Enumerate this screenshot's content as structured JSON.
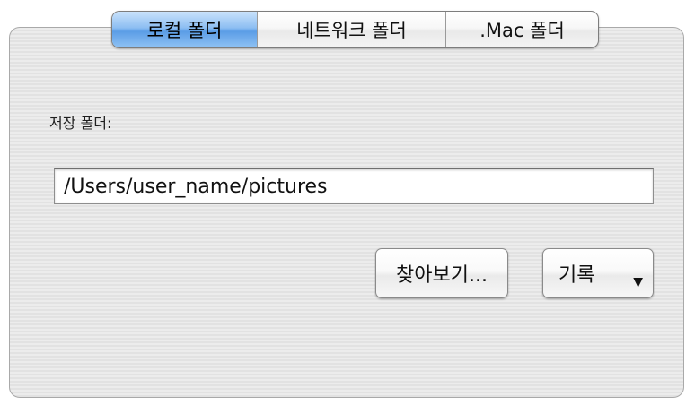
{
  "tabs": {
    "local_folder": "로컬 폴더",
    "network_folder": "네트워크 폴더",
    "mac_folder": ".Mac 폴더",
    "selected": "local_folder"
  },
  "save_folder": {
    "label": "저장 폴더:",
    "path": "/Users/user_name/pictures"
  },
  "buttons": {
    "browse": "찾아보기...",
    "history": "기록"
  },
  "icons": {
    "history_dropdown": "chevron-down-icon"
  },
  "colors": {
    "selected_tab": "#5b9de6"
  }
}
